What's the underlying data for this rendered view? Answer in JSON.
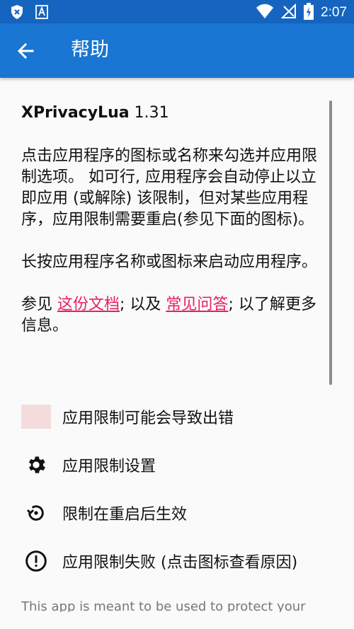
{
  "status_bar": {
    "time": "2:07",
    "icons": [
      "shield-icon",
      "font-icon",
      "wifi-icon",
      "no-signal-icon",
      "battery-charging-icon"
    ]
  },
  "app_bar": {
    "title": "帮助",
    "back_icon": "arrow-back-icon"
  },
  "help": {
    "app_name": "XPrivacyLua",
    "version": "1.31",
    "para1": "点击应用程序的图标或名称来勾选并应用限制选项。 如可行, 应用程序会自动停止以立即应用 (或解除) 该限制，但对某些应用程序，应用限制需要重启(参见下面的图标)。",
    "para2": "长按应用程序名称或图标来启动应用程序。",
    "para3_prefix": "参见 ",
    "link1": "这份文档",
    "para3_mid": "; 以及 ",
    "link2": "常见问答",
    "para3_suffix": "; 以了解更多信息。"
  },
  "legend": [
    {
      "icon": "pink-swatch",
      "label": "应用限制可能会导致出错"
    },
    {
      "icon": "gear-icon",
      "label": "应用限制设置"
    },
    {
      "icon": "restart-icon",
      "label": "限制在重启后生效"
    },
    {
      "icon": "error-icon",
      "label": "应用限制失败 (点击图标查看原因)"
    }
  ],
  "footer": "This app is meant to be used to protect your",
  "colors": {
    "status_bar": "#1565c0",
    "app_bar": "#1976d2",
    "link": "#e91e63",
    "swatch": "#f4dcdc"
  }
}
